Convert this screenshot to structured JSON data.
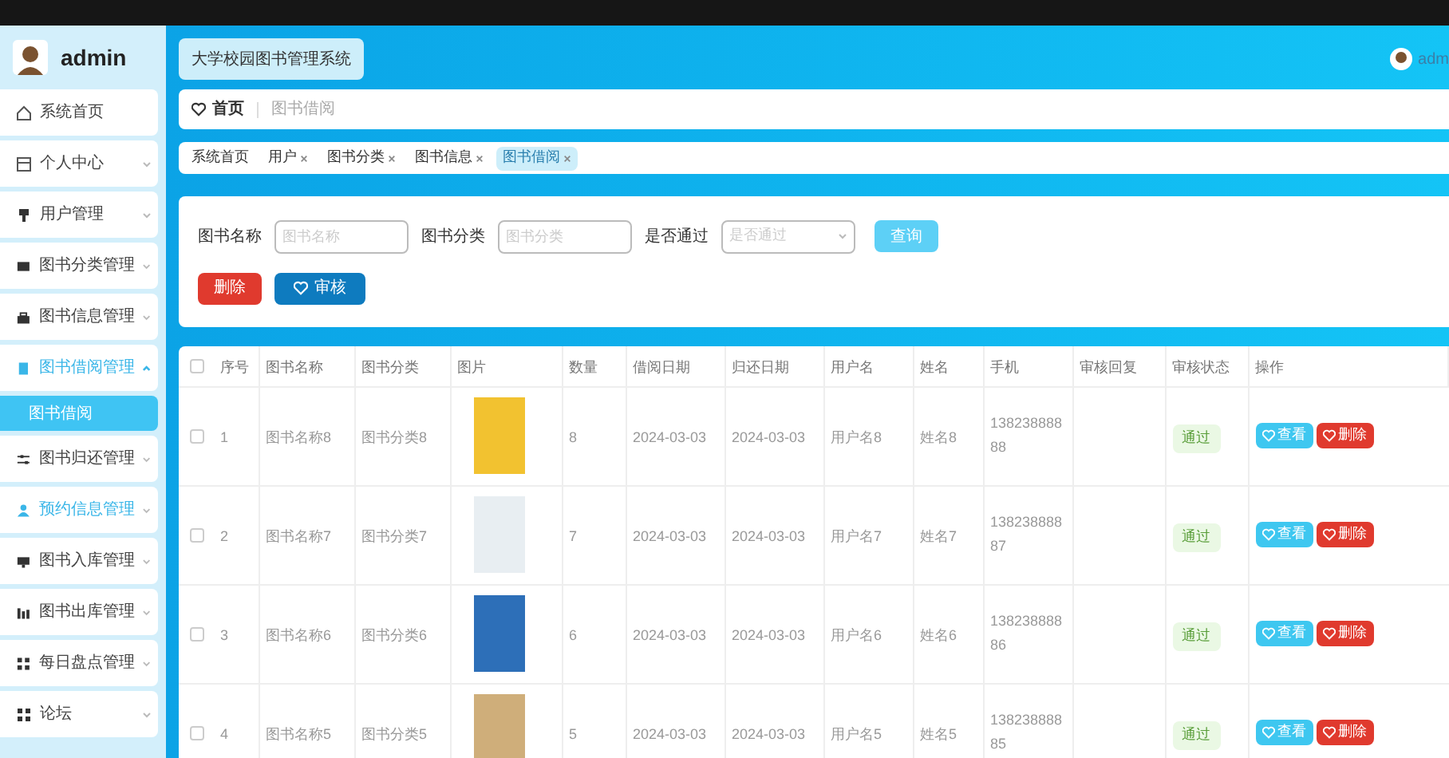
{
  "sidebar": {
    "user": "admin",
    "items": [
      {
        "label": "系统首页",
        "active": false
      },
      {
        "label": "个人中心",
        "expanded": false,
        "active": false
      },
      {
        "label": "用户管理",
        "expanded": false,
        "active": false
      },
      {
        "label": "图书分类管理",
        "expanded": false,
        "active": false
      },
      {
        "label": "图书信息管理",
        "expanded": false,
        "active": false
      },
      {
        "label": "图书借阅管理",
        "expanded": true,
        "active": true,
        "children": [
          {
            "label": "图书借阅",
            "selected": true
          }
        ]
      },
      {
        "label": "图书归还管理",
        "expanded": false,
        "active": false
      },
      {
        "label": "预约信息管理",
        "expanded": false,
        "active": true
      },
      {
        "label": "图书入库管理",
        "expanded": false,
        "active": false
      },
      {
        "label": "图书出库管理",
        "expanded": false,
        "active": false
      },
      {
        "label": "每日盘点管理",
        "expanded": false,
        "active": false
      },
      {
        "label": "论坛",
        "expanded": false,
        "active": false
      }
    ]
  },
  "header": {
    "title": "大学校园图书管理系统",
    "user": "adm"
  },
  "breadcrumb": {
    "home": "首页",
    "current": "图书借阅"
  },
  "tags": [
    {
      "label": "系统首页",
      "closable": false,
      "selected": false
    },
    {
      "label": "用户",
      "closable": true,
      "selected": false
    },
    {
      "label": "图书分类",
      "closable": true,
      "selected": false
    },
    {
      "label": "图书信息",
      "closable": true,
      "selected": false
    },
    {
      "label": "图书借阅",
      "closable": true,
      "selected": true
    }
  ],
  "search": {
    "fields": [
      {
        "label": "图书名称",
        "placeholder": "图书名称",
        "kind": "input"
      },
      {
        "label": "图书分类",
        "placeholder": "图书分类",
        "kind": "input"
      },
      {
        "label": "是否通过",
        "placeholder": "是否通过",
        "kind": "select"
      }
    ],
    "query_button": "查询",
    "delete_button": "删除",
    "review_button": "审核"
  },
  "table": {
    "all_checked": false,
    "columns": [
      "序号",
      "图书名称",
      "图书分类",
      "图片",
      "数量",
      "借阅日期",
      "归还日期",
      "用户名",
      "姓名",
      "手机",
      "审核回复",
      "审核状态",
      "操作"
    ],
    "rows": [
      {
        "checked": false,
        "no": "1",
        "name": "图书名称8",
        "category": "图书分类8",
        "quantity": "8",
        "borrow_date": "2024-03-03",
        "return_date": "2024-03-03",
        "username": "用户名8",
        "real_name": "姓名8",
        "phone": "13823888888",
        "status": "通过",
        "view": "查看",
        "delete": "删除"
      },
      {
        "checked": false,
        "no": "2",
        "name": "图书名称7",
        "category": "图书分类7",
        "quantity": "7",
        "borrow_date": "2024-03-03",
        "return_date": "2024-03-03",
        "username": "用户名7",
        "real_name": "姓名7",
        "phone": "13823888887",
        "status": "通过",
        "view": "查看",
        "delete": "删除"
      },
      {
        "checked": false,
        "no": "3",
        "name": "图书名称6",
        "category": "图书分类6",
        "quantity": "6",
        "borrow_date": "2024-03-03",
        "return_date": "2024-03-03",
        "username": "用户名6",
        "real_name": "姓名6",
        "phone": "13823888886",
        "status": "通过",
        "view": "查看",
        "delete": "删除"
      },
      {
        "checked": false,
        "no": "4",
        "name": "图书名称5",
        "category": "图书分类5",
        "quantity": "5",
        "borrow_date": "2024-03-03",
        "return_date": "2024-03-03",
        "username": "用户名5",
        "real_name": "姓名5",
        "phone": "13823888885",
        "status": "通过",
        "view": "查看",
        "delete": "删除"
      }
    ]
  }
}
